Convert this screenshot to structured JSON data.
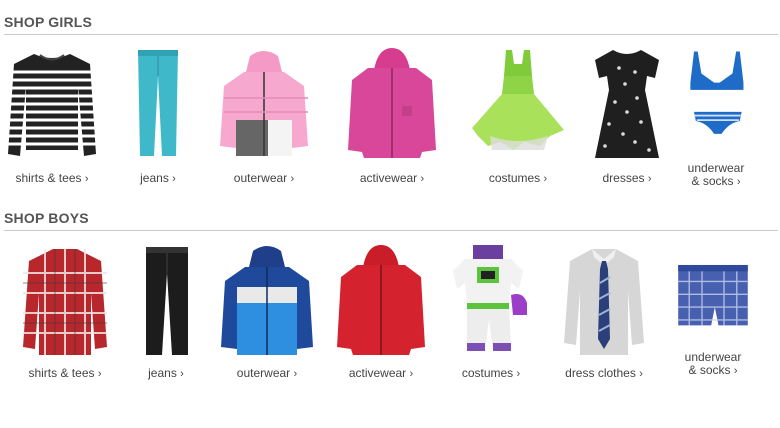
{
  "girls": {
    "title": "SHOP GIRLS",
    "items": [
      {
        "label": "shirts & tees",
        "icon": "striped-shirt-icon"
      },
      {
        "label": "jeans",
        "icon": "teal-jeans-icon"
      },
      {
        "label": "outerwear",
        "icon": "pink-puffer-jacket-icon"
      },
      {
        "label": "activewear",
        "icon": "pink-hoodie-icon"
      },
      {
        "label": "costumes",
        "icon": "fairy-costume-icon"
      },
      {
        "label": "dresses",
        "icon": "black-dress-icon"
      },
      {
        "label": "underwear",
        "label2": "& socks",
        "icon": "bra-and-underwear-icon"
      }
    ]
  },
  "boys": {
    "title": "SHOP BOYS",
    "items": [
      {
        "label": "shirts & tees",
        "icon": "plaid-shirt-icon"
      },
      {
        "label": "jeans",
        "icon": "black-jeans-icon"
      },
      {
        "label": "outerwear",
        "icon": "blue-puffer-jacket-icon"
      },
      {
        "label": "activewear",
        "icon": "red-hoodie-icon"
      },
      {
        "label": "costumes",
        "icon": "space-ranger-costume-icon"
      },
      {
        "label": "dress clothes",
        "icon": "dress-shirt-and-tie-icon"
      },
      {
        "label": "underwear",
        "label2": "& socks",
        "icon": "plaid-boxers-icon"
      }
    ]
  },
  "chevron": "›"
}
